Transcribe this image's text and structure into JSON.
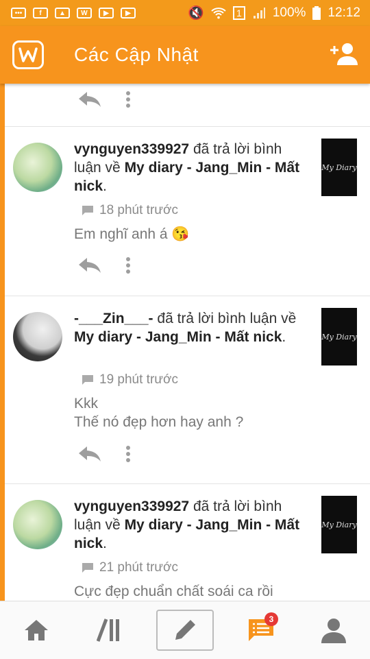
{
  "status_bar": {
    "battery": "100%",
    "time": "12:12",
    "sim": "1"
  },
  "app_bar": {
    "title": "Các Cập Nhật"
  },
  "colors": {
    "accent": "#f7941d",
    "badge": "#e53935"
  },
  "notifications": [
    {
      "user": "vynguyen339927",
      "action": "đã trả lời bình luận về",
      "story": "My diary - Jang_Min - Mất nick",
      "time": "18 phút trước",
      "text": "Em nghĩ anh á 😘",
      "thumb_text": "My Diary"
    },
    {
      "user": "-___Zin___-",
      "action": "đã trả lời bình luận về",
      "story": "My diary - Jang_Min - Mất nick",
      "time": "19 phút trước",
      "text": "Kkk\nThế nó đẹp hơn hay anh ?",
      "thumb_text": "My Diary"
    },
    {
      "user": "vynguyen339927",
      "action": "đã trả lời bình luận về",
      "story": "My diary - Jang_Min - Mất nick",
      "time": "21 phút trước",
      "text": "Cực đẹp chuẩn chất soái ca rồi",
      "thumb_text": "My Diary"
    }
  ],
  "bottom_nav": {
    "notifications_badge": "3"
  }
}
